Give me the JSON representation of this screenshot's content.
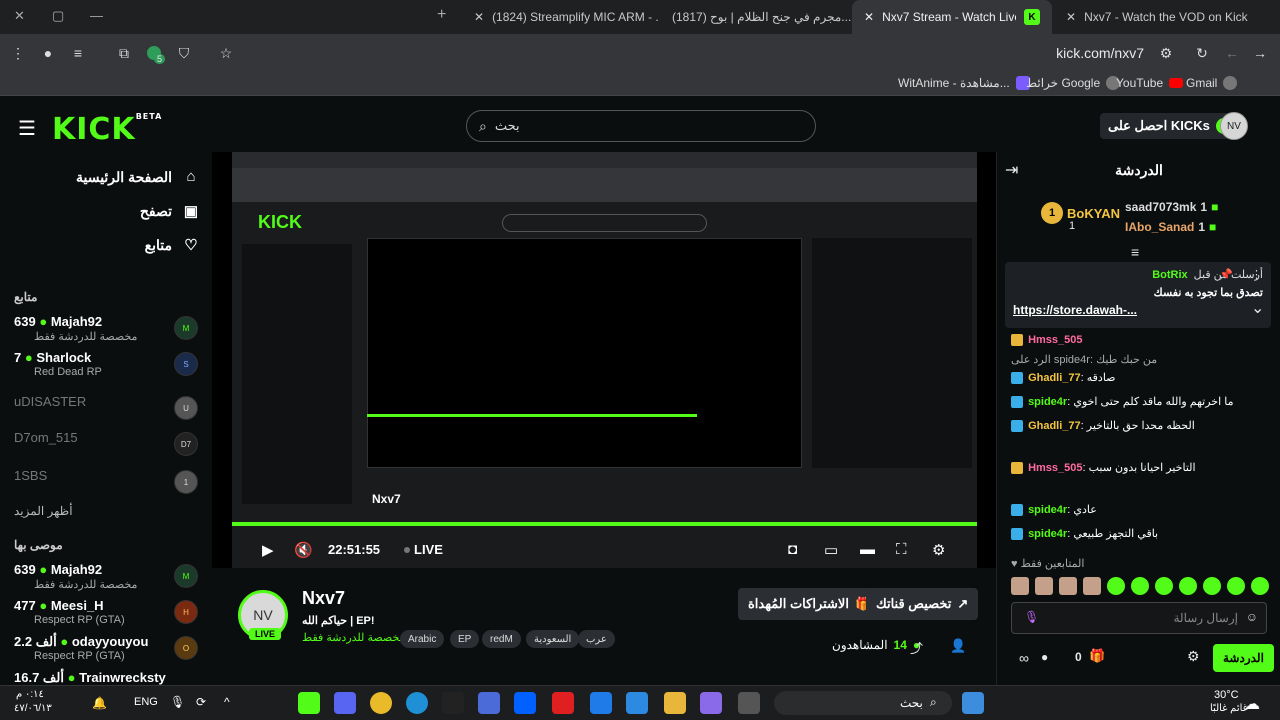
{
  "browser": {
    "tabs": [
      {
        "title": "(1824) Streamplify MIC ARM - ..."
      },
      {
        "title": "(1817) مجرم في جنح الظلام | بوح..."
      },
      {
        "title": "Nxv7 Stream - Watch Live on Kick"
      },
      {
        "title": "Nxv7 - Watch the VOD on Kick"
      }
    ],
    "url": "kick.com/nxv7",
    "extension_badge": "5",
    "bookmarks": [
      "WitAnime - مشاهدة...",
      "خرائط Google",
      "YouTube",
      "Gmail"
    ]
  },
  "header": {
    "logo": "KICK",
    "logo_sup": "BETA",
    "search_placeholder": "بحث",
    "get_kicks": "احصل على KICKs"
  },
  "sidebar": {
    "nav": [
      {
        "label": "الصفحة الرئيسية"
      },
      {
        "label": "تصفح"
      },
      {
        "label": "متابع"
      }
    ],
    "following_title": "متابع",
    "following": [
      {
        "name": "Majah92",
        "count": "639",
        "game": "مخصصة للدردشة فقط"
      },
      {
        "name": "Sharlock",
        "count": "7",
        "game": "Red Dead RP"
      },
      {
        "name": "uDISASTER",
        "count": "",
        "game": ""
      },
      {
        "name": "D7om_515",
        "count": "",
        "game": ""
      },
      {
        "name": "1SBS",
        "count": "",
        "game": ""
      }
    ],
    "show_more": "أظهر المزيد",
    "recommended_title": "موصى بها",
    "recommended": [
      {
        "name": "Majah92",
        "count": "639",
        "game": "مخصصة للدردشة فقط"
      },
      {
        "name": "Meesi_H",
        "count": "477",
        "game": "Respect RP (GTA)"
      },
      {
        "name": "odayyouyou",
        "count": "2.2 ألف",
        "game": "Respect RP (GTA)"
      },
      {
        "name": "Trainwrecksty",
        "count": "16.7 ألف",
        "game": ""
      }
    ]
  },
  "player": {
    "time": "22:51:55",
    "live_label": "LIVE"
  },
  "stream": {
    "name": "Nxv7",
    "title": "حياكم الله | EP!",
    "category": "مخصصة للدردشة فقط",
    "live_badge": "LIVE",
    "tags": [
      "Arabic",
      "EP",
      "redM",
      "السعودية",
      "عرب"
    ],
    "customize_btn": "تخصيص قناتك",
    "gift_btn": "الاشتراكات المُهداة",
    "viewers_label": "المشاهدون",
    "viewers": "14"
  },
  "chat": {
    "title": "الدردشة",
    "leaders": [
      {
        "name": "BoKYAN",
        "count": "1"
      },
      {
        "name": "saad7073mk",
        "count": "1"
      },
      {
        "name": "IAbo_Sanad",
        "count": "1"
      }
    ],
    "pinned_by_label": "أرسلت من قبل",
    "pinned_by": "BotRix",
    "pinned_message": "تصدق بما تجود به نفسك",
    "pinned_link": "https://store.dawah-...",
    "messages": [
      {
        "user": "Hmss_505",
        "text": ""
      },
      {
        "user": "spide4r",
        "text": "الرد على spide4r: من حبك طيك"
      },
      {
        "user": "Ghadli_77",
        "text": "صادقه"
      },
      {
        "user": "spide4r",
        "text": "ما اخرتهم والله ماقد كلم حتى اخوي"
      },
      {
        "user": "Ghadli_77",
        "text": "الحظه محدا حق بالتاخير"
      },
      {
        "user": "Hmss_505",
        "text": "التاخير احيانا بدون سبب"
      },
      {
        "user": "spide4r",
        "text": "عادي"
      },
      {
        "user": "spide4r",
        "text": "باقي التجهز طبيعي"
      }
    ],
    "emotes_label": "المتابعين فقط",
    "input_placeholder": "إرسال رسالة",
    "send_btn": "الدردشة",
    "kicks_count": "0"
  },
  "taskbar": {
    "search": "بحث",
    "lang": "ENG",
    "time": "٠:١٤ م",
    "date": "٤٧/٠٦/١٣",
    "weather_temp": "30°C",
    "weather_desc": "غائم غالبًا"
  }
}
